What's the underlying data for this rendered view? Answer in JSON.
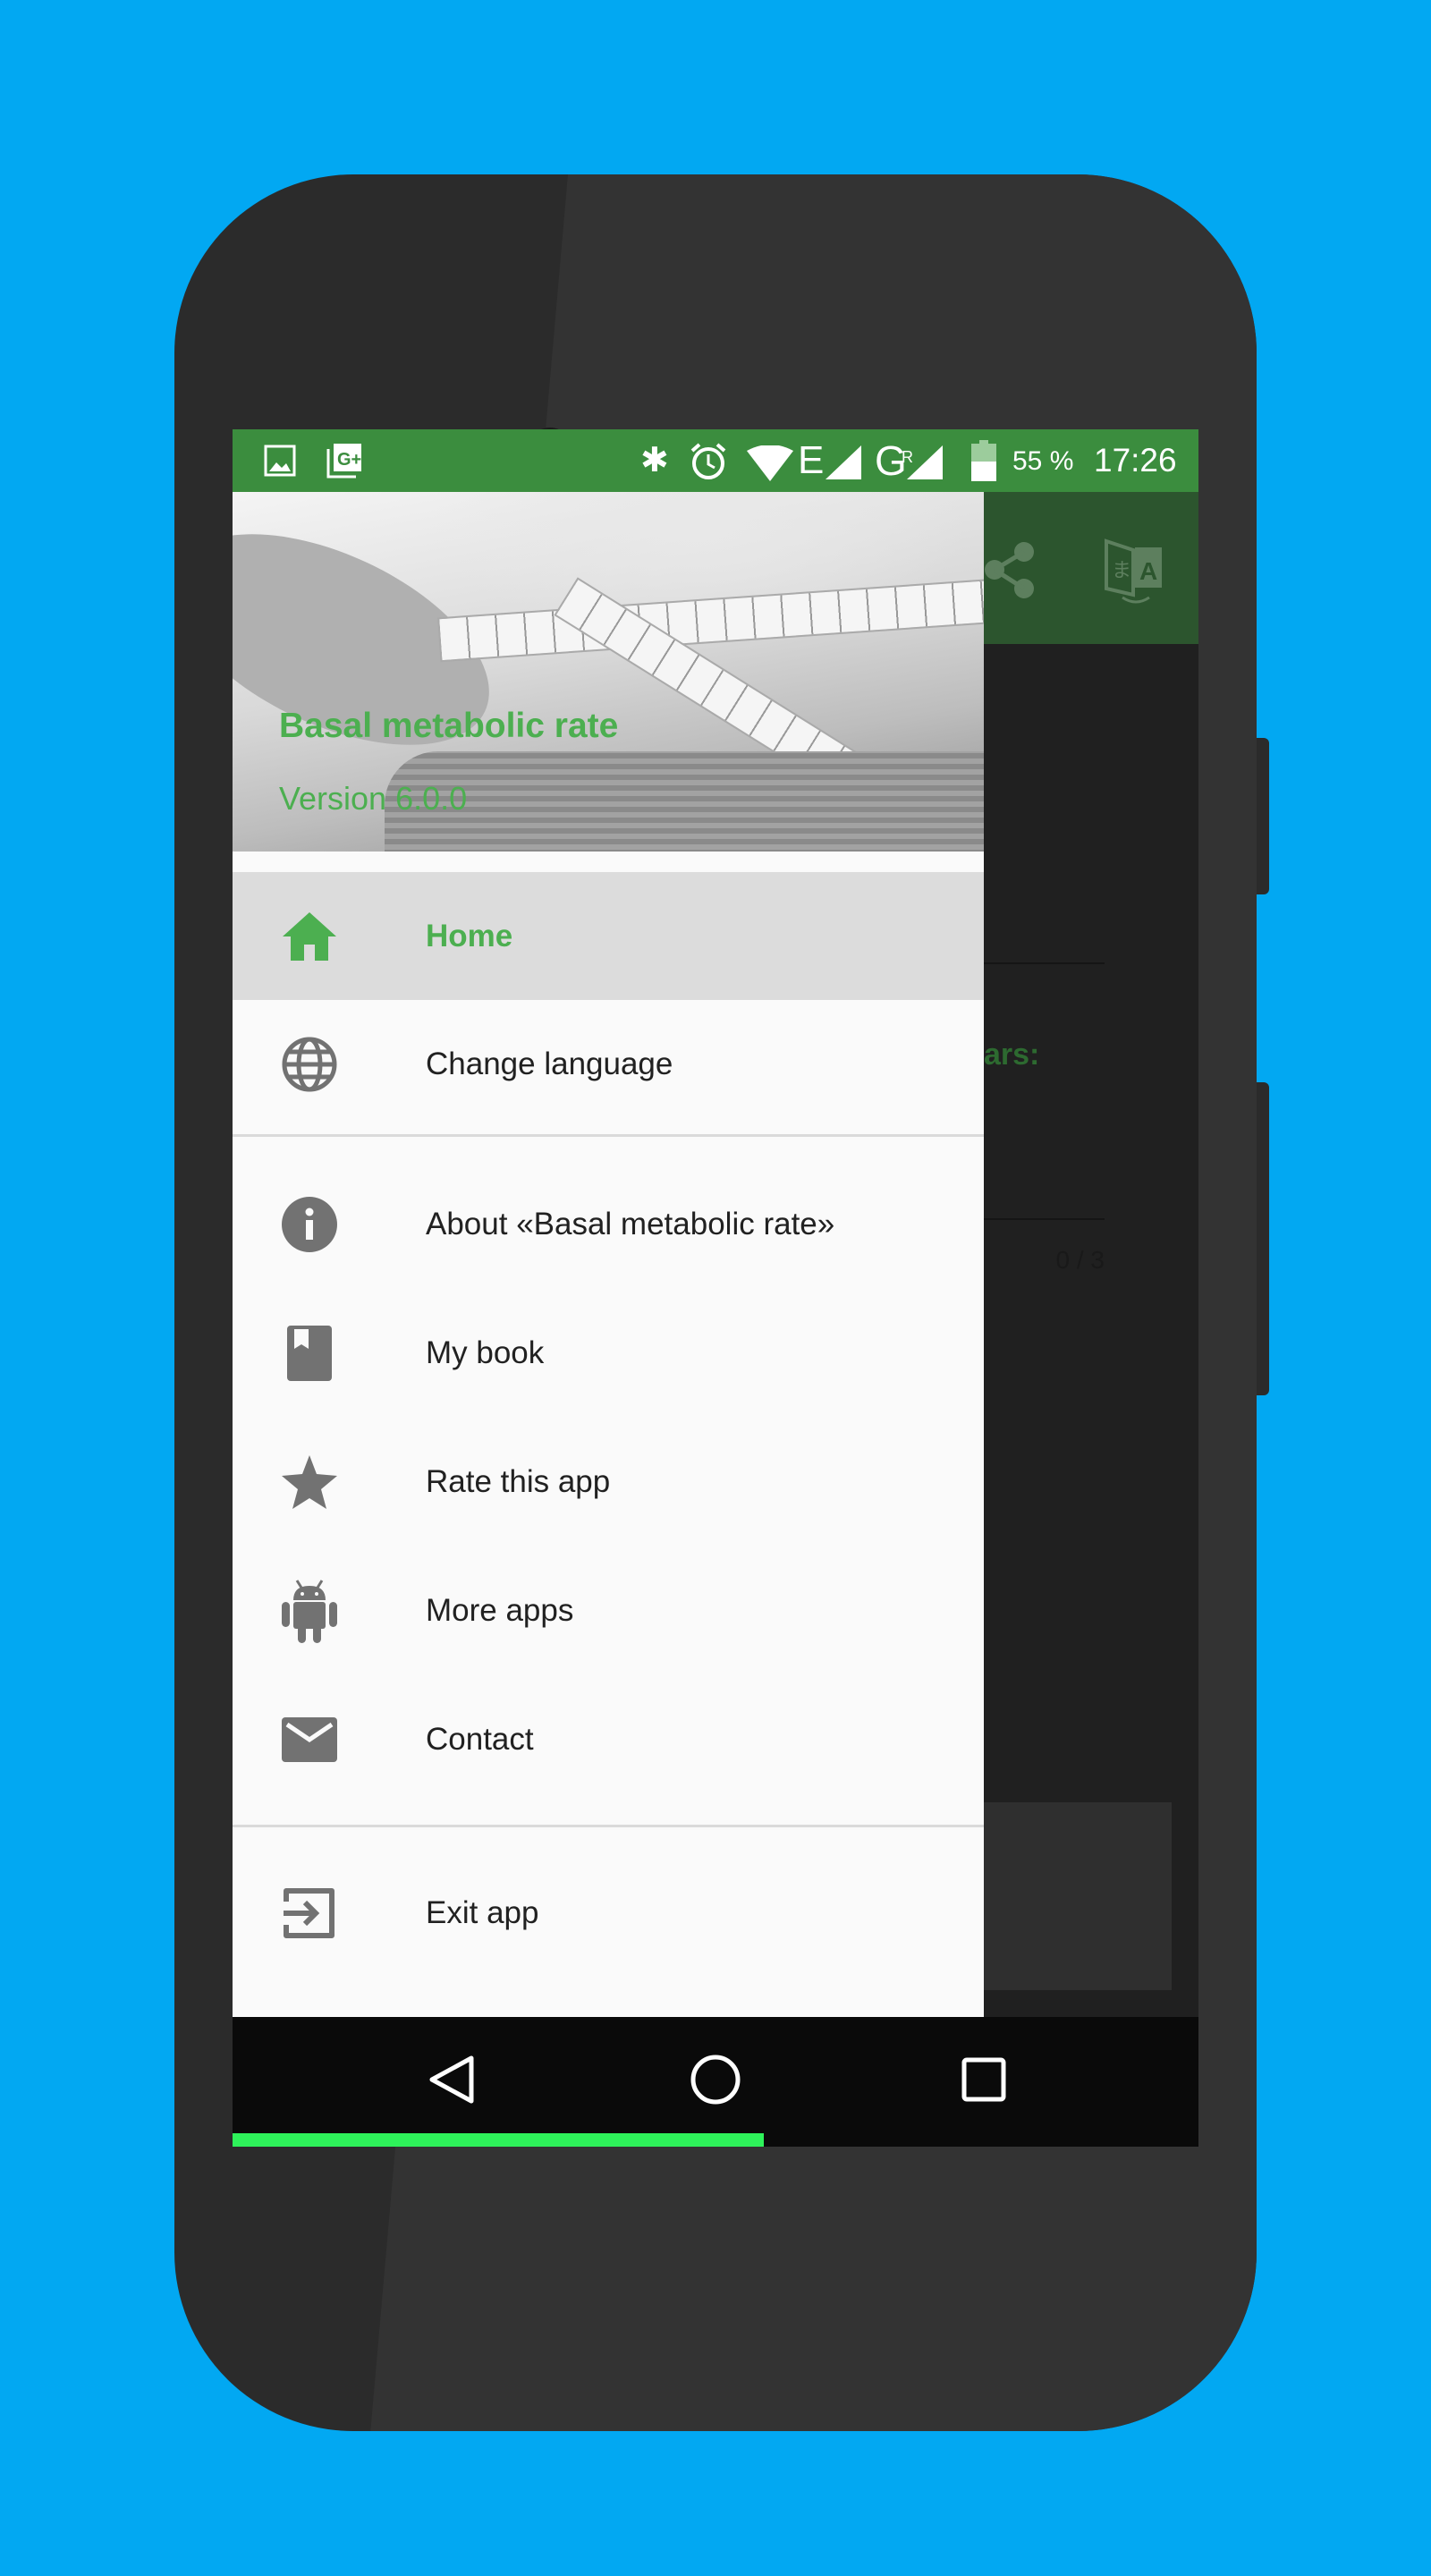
{
  "status_bar": {
    "left_icons": [
      "image-icon",
      "google-plus-icon"
    ],
    "right_icons": [
      "bluetooth-icon",
      "alarm-icon",
      "wifi-icon",
      "signal-e-icon",
      "signal-g-roaming-icon",
      "battery-icon"
    ],
    "battery": "55 %",
    "time": "17:26",
    "network_e": "E",
    "network_g": "G",
    "roaming": "R"
  },
  "app_bar": {
    "icons": [
      "share-icon",
      "translate-icon"
    ]
  },
  "background_content": {
    "label_fragment": "ars:",
    "counter": "0 / 3"
  },
  "drawer": {
    "header": {
      "title": "Basal metabolic rate",
      "version": "Version 6.0.0"
    },
    "items": [
      {
        "label": "Home",
        "icon": "home-icon",
        "selected": true
      },
      {
        "label": "Change language",
        "icon": "globe-icon"
      },
      {
        "label": "About «Basal metabolic rate»",
        "icon": "info-icon"
      },
      {
        "label": "My book",
        "icon": "book-icon"
      },
      {
        "label": "Rate this app",
        "icon": "star-icon"
      },
      {
        "label": "More apps",
        "icon": "android-icon"
      },
      {
        "label": "Contact",
        "icon": "mail-icon"
      },
      {
        "label": "Exit app",
        "icon": "exit-icon"
      }
    ]
  },
  "nav_bar": {
    "buttons": [
      "back-icon",
      "home-circle-icon",
      "recents-icon"
    ]
  },
  "colors": {
    "accent": "#4caf50",
    "status_bar": "#3b8d3e",
    "background": "#02a8f2",
    "progress": "#2ef25a"
  }
}
